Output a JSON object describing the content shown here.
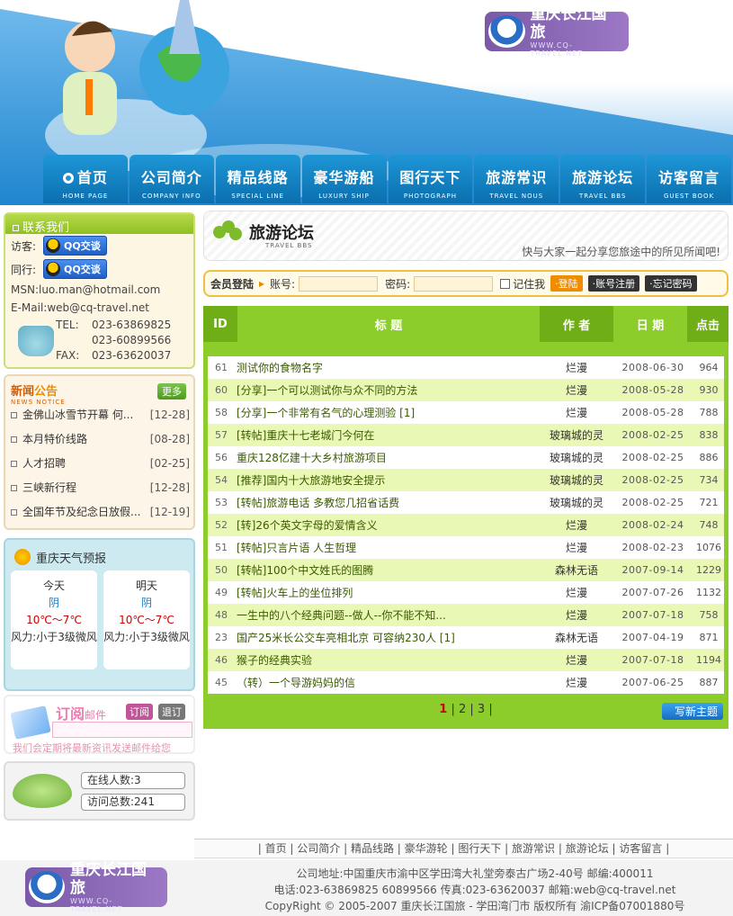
{
  "brand": {
    "name": "重庆长江国旅",
    "url": "WWW.CQ-TRAVEL.NET"
  },
  "nav": [
    {
      "zh": "首页",
      "en": "HOME PAGE"
    },
    {
      "zh": "公司简介",
      "en": "COMPANY INFO"
    },
    {
      "zh": "精品线路",
      "en": "SPECIAL LINE"
    },
    {
      "zh": "豪华游船",
      "en": "LUXURY SHIP"
    },
    {
      "zh": "图行天下",
      "en": "PHOTOGRAPH"
    },
    {
      "zh": "旅游常识",
      "en": "TRAVEL NOUS"
    },
    {
      "zh": "旅游论坛",
      "en": "TRAVEL BBS"
    },
    {
      "zh": "访客留言",
      "en": "GUEST BOOK"
    }
  ],
  "contact": {
    "title": "联系我们",
    "visitor_label": "访客:",
    "peer_label": "同行:",
    "qq_label": "QQ交谈",
    "msn": "MSN:luo.man@hotmail.com",
    "email": "E-Mail:web@cq-travel.net",
    "tel_label": "TEL:",
    "tel1": "023-63869825",
    "tel2": "023-60899566",
    "fax_label": "FAX:",
    "fax": "023-63620037"
  },
  "notice": {
    "title_a": "新闻",
    "title_b": "公告",
    "en": "NEWS NOTICE",
    "more": "更多",
    "items": [
      {
        "text": "金佛山冰雪节开幕 何...",
        "date": "[12-28]"
      },
      {
        "text": "本月特价线路",
        "date": "[08-28]"
      },
      {
        "text": "人才招聘",
        "date": "[02-25]"
      },
      {
        "text": "三峡新行程",
        "date": "[12-28]"
      },
      {
        "text": "全国年节及纪念日放假...",
        "date": "[12-19]"
      }
    ]
  },
  "weather": {
    "title": "重庆天气预报",
    "days": [
      {
        "day": "今天",
        "cond": "阴",
        "temp": "10℃～7℃",
        "wind": "风力:小于3级微风"
      },
      {
        "day": "明天",
        "cond": "阴",
        "temp": "10℃～7℃",
        "wind": "风力:小于3级微风"
      }
    ]
  },
  "subscribe": {
    "title": "订阅",
    "title_small": "邮件",
    "sub_btn": "订阅",
    "unsub_btn": "退订",
    "note": "我们会定期将最新资讯发送邮件给您"
  },
  "stats": {
    "online": "在线人数:3",
    "total": "访问总数:241"
  },
  "forum": {
    "title": "旅游论坛",
    "en": "TRAVEL BBS",
    "subtitle": "快与大家一起分享您旅途中的所见所闻吧!"
  },
  "login": {
    "label": "会员登陆",
    "user_label": "账号:",
    "pass_label": "密码:",
    "remember": "记住我",
    "login_btn": "·登陆",
    "register_btn": "·账号注册",
    "forgot_btn": "·忘记密码"
  },
  "table": {
    "headers": {
      "id": "ID",
      "title": "标  题",
      "author": "作  者",
      "date": "日  期",
      "clicks": "点击"
    },
    "rows": [
      {
        "id": "61",
        "title": "测试你的食物名字",
        "author": "烂漫",
        "date": "2008-06-30",
        "clicks": "964"
      },
      {
        "id": "60",
        "title": "[分享]一个可以测试你与众不同的方法",
        "author": "烂漫",
        "date": "2008-05-28",
        "clicks": "930"
      },
      {
        "id": "58",
        "title": "[分享]一个非常有名气的心理测验  [1]",
        "author": "烂漫",
        "date": "2008-05-28",
        "clicks": "788"
      },
      {
        "id": "57",
        "title": "[转帖]重庆十七老城门今何在",
        "author": "玻璃城的灵",
        "date": "2008-02-25",
        "clicks": "838"
      },
      {
        "id": "56",
        "title": "重庆128亿建十大乡村旅游项目",
        "author": "玻璃城的灵",
        "date": "2008-02-25",
        "clicks": "886"
      },
      {
        "id": "54",
        "title": "[推荐]国内十大旅游地安全提示",
        "author": "玻璃城的灵",
        "date": "2008-02-25",
        "clicks": "734"
      },
      {
        "id": "53",
        "title": "[转帖]旅游电话  多教您几招省话费",
        "author": "玻璃城的灵",
        "date": "2008-02-25",
        "clicks": "721"
      },
      {
        "id": "52",
        "title": "[转]26个英文字母的爱情含义",
        "author": "烂漫",
        "date": "2008-02-24",
        "clicks": "748"
      },
      {
        "id": "51",
        "title": "[转帖]只言片语  人生哲理",
        "author": "烂漫",
        "date": "2008-02-23",
        "clicks": "1076"
      },
      {
        "id": "50",
        "title": "[转帖]100个中文姓氏的图腾",
        "author": "森林无语",
        "date": "2007-09-14",
        "clicks": "1229"
      },
      {
        "id": "49",
        "title": "[转帖]火车上的坐位排列",
        "author": "烂漫",
        "date": "2007-07-26",
        "clicks": "1132"
      },
      {
        "id": "48",
        "title": "一生中的八个经典问题--做人--你不能不知...",
        "author": "烂漫",
        "date": "2007-07-18",
        "clicks": "758"
      },
      {
        "id": "23",
        "title": "国产25米长公交车亮相北京  可容纳230人  [1]",
        "author": "森林无语",
        "date": "2007-04-19",
        "clicks": "871"
      },
      {
        "id": "46",
        "title": "猴子的经典实验",
        "author": "烂漫",
        "date": "2007-07-18",
        "clicks": "1194"
      },
      {
        "id": "45",
        "title": "（转）一个导游妈妈的信",
        "author": "烂漫",
        "date": "2007-06-25",
        "clicks": "887"
      }
    ]
  },
  "pager": {
    "p1": "1",
    "p2": "2",
    "p3": "3"
  },
  "new_topic": "写新主题",
  "footnav": [
    "首页",
    "公司简介",
    "精品线路",
    "豪华游轮",
    "图行天下",
    "旅游常识",
    "旅游论坛",
    "访客留言"
  ],
  "footer": {
    "address": "公司地址:中国重庆市渝中区学田湾大礼堂旁泰古广场2-40号 邮编:400011",
    "phone": "电话:023-63869825 60899566 传真:023-63620037 邮箱:web@cq-travel.net",
    "copyright": "CopyRight © 2005-2007 重庆长江国旅 - 学田湾门市 版权所有 渝ICP备07001880号"
  },
  "colors": {
    "accent_green": "#8ccd2c",
    "nav_blue": "#1e96d6",
    "title_green": "#3b5a00"
  }
}
